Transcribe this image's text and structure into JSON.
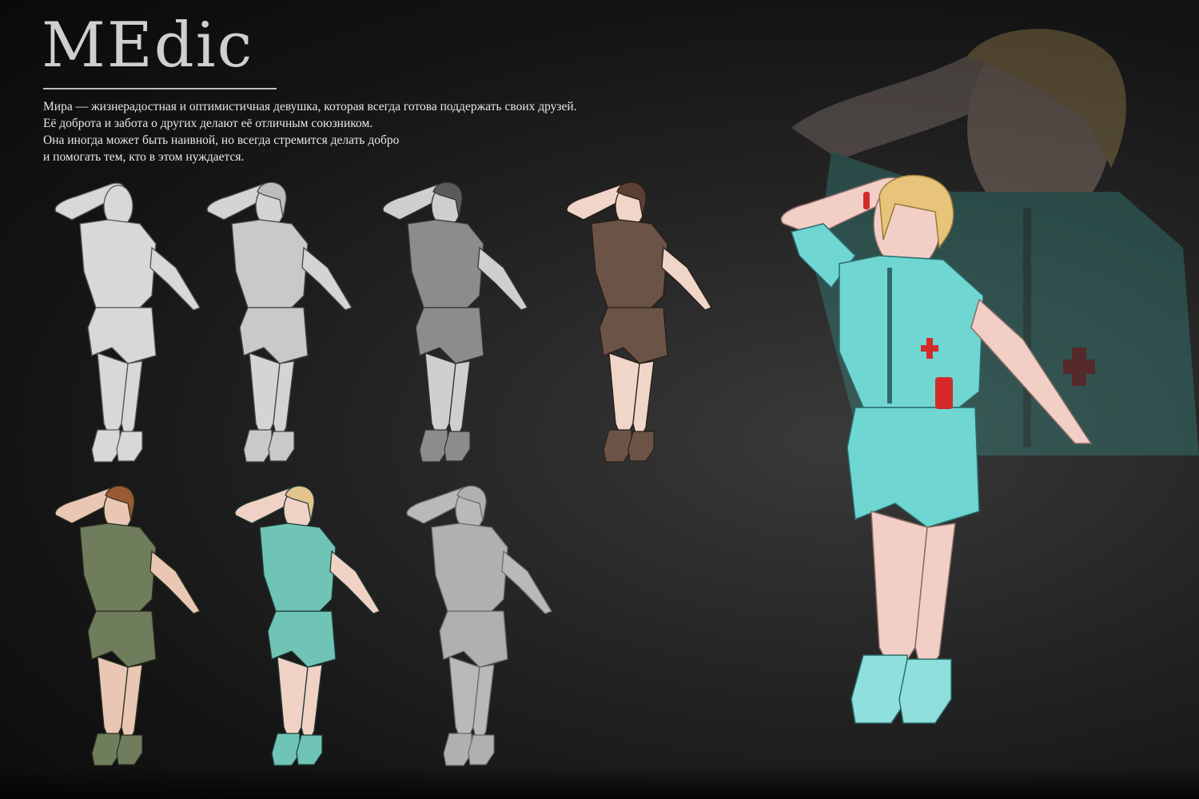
{
  "sheet": {
    "title": "MEdic",
    "description": [
      "Мира — жизнерадостная и оптимистичная девушка, которая всегда готова поддержать своих друзей.",
      "Её доброта и забота о других делают её отличным союзником.",
      "Она иногда может быть наивной, но всегда стремится делать добро",
      "и помогать тем, кто в этом нуждается."
    ]
  },
  "figures": [
    {
      "stage": "anatomy-sketch",
      "skin": "#d8d8d8",
      "suit": "#d8d8d8",
      "hair": "#d8d8d8",
      "line": "#555555"
    },
    {
      "stage": "lineart-light",
      "skin": "#d4d4d4",
      "suit": "#c9c9c9",
      "hair": "#bcbcbc",
      "line": "#444444"
    },
    {
      "stage": "grey-values",
      "skin": "#cfcfcf",
      "suit": "#8c8c8c",
      "hair": "#5a5a5a",
      "line": "#333333"
    },
    {
      "stage": "brown-variant",
      "skin": "#f0d6c8",
      "suit": "#6b5447",
      "hair": "#5a4035",
      "line": "#2a1e18"
    },
    {
      "stage": "olive-variant",
      "skin": "#e9c7b4",
      "suit": "#6f7d5c",
      "hair": "#9a5a32",
      "line": "#2b3020"
    },
    {
      "stage": "teal-variant",
      "skin": "#f0d2c4",
      "suit": "#6fc4b5",
      "hair": "#e2c48c",
      "line": "#1e3a36"
    },
    {
      "stage": "grey-outline",
      "skin": "#b9b9b9",
      "suit": "#b0b0b0",
      "hair": "#b0b0b0",
      "line": "#6a6a6a"
    }
  ],
  "final": {
    "skin": "#f2cfc6",
    "suit": "#6fd6d2",
    "hair": "#e7c47a",
    "accent": "#d42a2a",
    "line": "#2c6a6a"
  }
}
